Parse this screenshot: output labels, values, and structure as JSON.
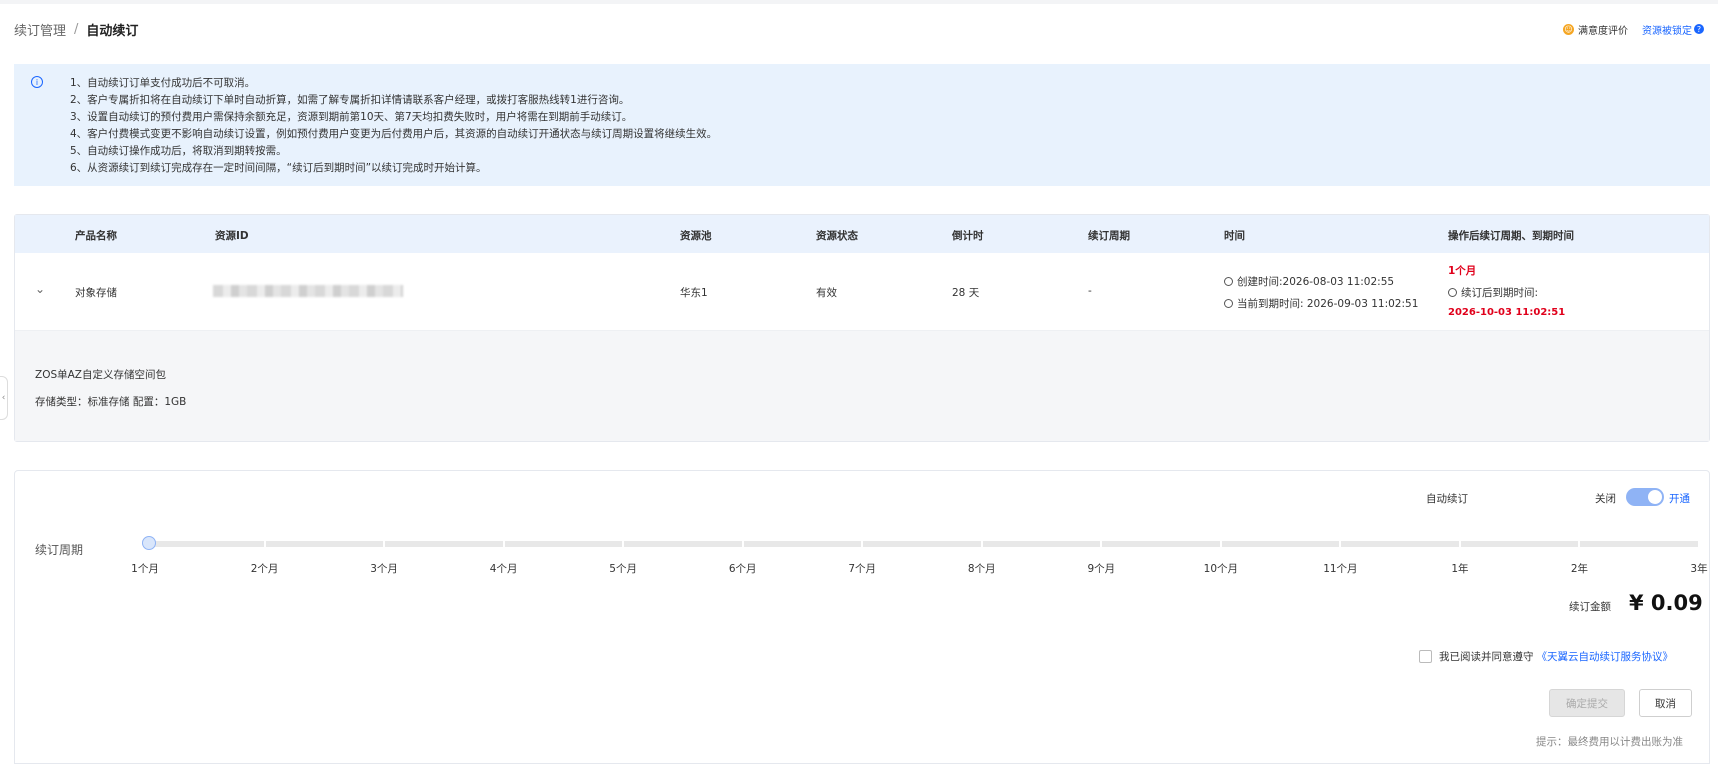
{
  "breadcrumb": {
    "parent": "续订管理",
    "separator": "/",
    "current": "自动续订"
  },
  "header_actions": {
    "satisfaction": "满意度评价",
    "resource_locked": "资源被锁定",
    "help_icon": "?"
  },
  "notice": {
    "icon": "info-icon",
    "items": [
      "1、自动续订订单支付成功后不可取消。",
      "2、客户专属折扣将在自动续订下单时自动折算，如需了解专属折扣详情请联系客户经理，或拨打客服热线转1进行咨询。",
      "3、设置自动续订的预付费用户需保持余额充足，资源到期前第10天、第7天均扣费失败时，用户将需在到期前手动续订。",
      "4、客户付费模式变更不影响自动续订设置，例如预付费用户变更为后付费用户后，其资源的自动续订开通状态与续订周期设置将继续生效。",
      "5、自动续订操作成功后，将取消到期转按需。",
      "6、从资源续订到续订完成存在一定时间间隔，“续订后到期时间”以续订完成时开始计算。"
    ]
  },
  "table": {
    "headers": [
      "产品名称",
      "资源ID",
      "资源池",
      "资源状态",
      "倒计时",
      "续订周期",
      "时间",
      "操作后续订周期、到期时间"
    ],
    "row": {
      "product": "对象存储",
      "pool": "华东1",
      "status": "有效",
      "countdown": "28 天",
      "period": "-",
      "created": "创建时间:2026-08-03 11:02:55",
      "current_expiry": "当前到期时间: 2026-09-03 11:02:51",
      "new_period": "1个月",
      "new_expiry_label": "续订后到期时间:",
      "new_expiry": "2026-10-03 11:02:51"
    },
    "detail": {
      "title": "ZOS单AZ自定义存储空间包",
      "spec": "存储类型：标准存储 配置：1GB"
    }
  },
  "renew_panel": {
    "auto_renew_label": "自动续订",
    "toggle_off": "关闭",
    "toggle_on": "开通",
    "toggle_state": "on",
    "period_label": "续订周期",
    "ticks": [
      "1个月",
      "2个月",
      "3个月",
      "4个月",
      "5个月",
      "6个月",
      "7个月",
      "8个月",
      "9个月",
      "10个月",
      "11个月",
      "1年",
      "2年",
      "3年"
    ],
    "selected_tick": "1个月",
    "price_label": "续订金额",
    "price": "¥ 0.09",
    "agree_text": "我已阅读并同意遵守",
    "agree_link": "《天翼云自动续订服务协议》",
    "confirm": "确定提交",
    "cancel": "取消",
    "hint": "提示：最终费用以计费出账为准"
  },
  "colors": {
    "accent": "#1a66ff",
    "notice_bg": "#e8f2fd",
    "red": "#e0001b"
  }
}
